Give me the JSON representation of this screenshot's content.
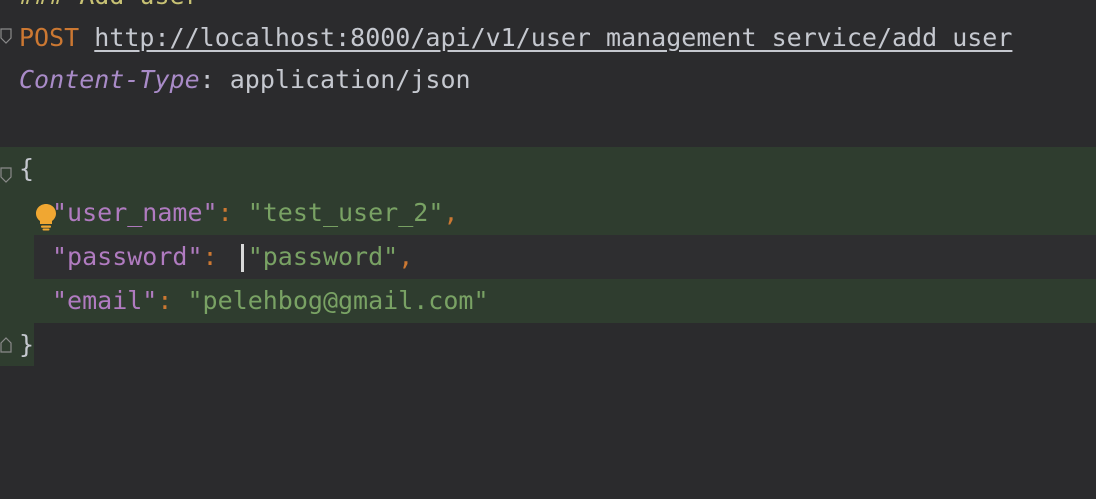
{
  "editor": {
    "lines": {
      "comment": "### Add user",
      "method": "POST",
      "url": "http://localhost:8000/api/v1/user_management_service/add_user",
      "header_key": "Content-Type",
      "header_colon": ":",
      "header_value": "application/json",
      "open_brace": "{",
      "close_brace": "}",
      "field1_key": "\"user_name\"",
      "field1_value": "\"test_user_2\"",
      "field2_key": "\"password\"",
      "field2_value": "\"password\"",
      "field3_key": "\"email\"",
      "field3_value": "\"pelehbog@gmail.com\"",
      "colon": ":",
      "comma": ","
    },
    "colors": {
      "background": "#2b2b2d",
      "highlight_green": "#2f3d2f",
      "method": "#cc7832",
      "string": "#79a264",
      "key": "#b07bc0",
      "bulb": "#f0a732"
    },
    "icons": {
      "bulb": "lightbulb-icon",
      "fold": "fold-marker-icon"
    }
  }
}
